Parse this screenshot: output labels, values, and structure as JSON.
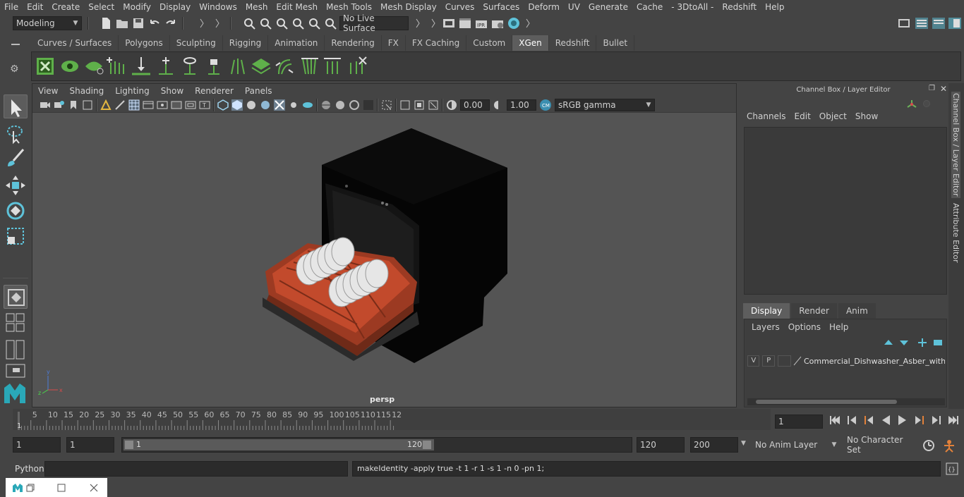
{
  "menubar": {
    "items": [
      "File",
      "Edit",
      "Create",
      "Select",
      "Modify",
      "Display",
      "Windows",
      "Mesh",
      "Edit Mesh",
      "Mesh Tools",
      "Mesh Display",
      "Curves",
      "Surfaces",
      "Deform",
      "UV",
      "Generate",
      "Cache",
      "- 3DtoAll -",
      "Redshift",
      "Help"
    ]
  },
  "statusline": {
    "mode": "Modeling",
    "live_surface": "No Live Surface"
  },
  "shelf": {
    "tabs": [
      "Curves / Surfaces",
      "Polygons",
      "Sculpting",
      "Rigging",
      "Animation",
      "Rendering",
      "FX",
      "FX Caching",
      "Custom",
      "XGen",
      "Redshift",
      "Bullet"
    ],
    "active_tab": "XGen"
  },
  "viewport": {
    "menu": [
      "View",
      "Shading",
      "Lighting",
      "Show",
      "Renderer",
      "Panels"
    ],
    "exposure": "0.00",
    "gamma": "1.00",
    "color_space": "sRGB gamma",
    "camera_label": "persp"
  },
  "channel_box": {
    "title": "Channel Box / Layer Editor",
    "menu": [
      "Channels",
      "Edit",
      "Object",
      "Show"
    ]
  },
  "layer_editor": {
    "tabs": [
      "Display",
      "Render",
      "Anim"
    ],
    "active_tab": "Display",
    "menu": [
      "Layers",
      "Options",
      "Help"
    ],
    "layer": {
      "v": "V",
      "p": "P",
      "name": "Commercial_Dishwasher_Asber_with_"
    }
  },
  "side_tabs": [
    "Channel Box / Layer Editor",
    "Attribute Editor"
  ],
  "timeline": {
    "ticks": [
      "5",
      "10",
      "15",
      "20",
      "25",
      "30",
      "35",
      "40",
      "45",
      "50",
      "55",
      "60",
      "65",
      "70",
      "75",
      "80",
      "85",
      "90",
      "95",
      "100",
      "105",
      "110",
      "115",
      "12"
    ],
    "start_marker": "1",
    "current_frame": "1"
  },
  "range": {
    "start": "1",
    "playback_start": "1",
    "slider_start": "1",
    "slider_end": "120",
    "playback_end": "120",
    "end": "200",
    "anim_layer": "No Anim Layer",
    "character_set": "No Character Set"
  },
  "command": {
    "language": "Python",
    "output": "makeIdentity -apply true -t 1 -r 1 -s 1 -n 0 -pn 1;"
  },
  "colors": {
    "accent": "#5ec2d9",
    "shelf_green": "#5fb04a",
    "rack": "#b5462a"
  }
}
